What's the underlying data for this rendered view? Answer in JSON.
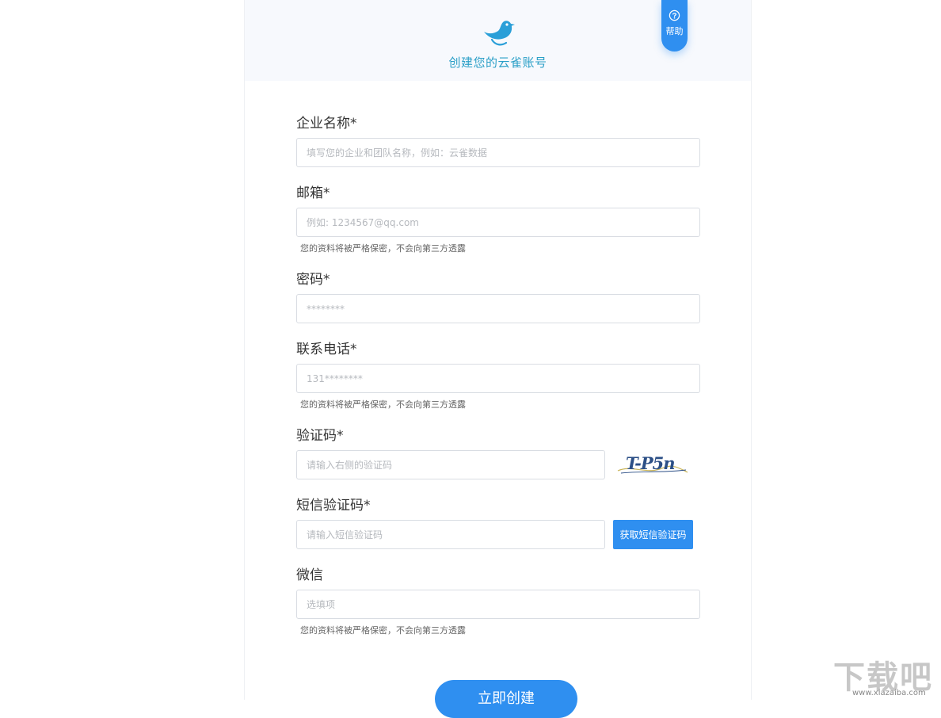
{
  "header": {
    "brand_title": "创建您的云雀账号",
    "help_label": "帮助"
  },
  "form": {
    "company": {
      "label": "企业名称*",
      "placeholder": "填写您的企业和团队名称，例如：云雀数据"
    },
    "email": {
      "label": "邮箱*",
      "placeholder": "例如: 1234567@qq.com",
      "hint": "您的资料将被严格保密，不会向第三方透露"
    },
    "password": {
      "label": "密码*",
      "placeholder": "********"
    },
    "phone": {
      "label": "联系电话*",
      "placeholder": "131********",
      "hint": "您的资料将被严格保密，不会向第三方透露"
    },
    "captcha": {
      "label": "验证码*",
      "placeholder": "请输入右侧的验证码",
      "image_text": "T-P5n"
    },
    "sms": {
      "label": "短信验证码*",
      "placeholder": "请输入短信验证码",
      "button_label": "获取短信验证码"
    },
    "wechat": {
      "label": "微信",
      "placeholder": "选填项",
      "hint": "您的资料将被严格保密，不会向第三方透露"
    },
    "submit_label": "立即创建"
  },
  "watermark": {
    "brand": "下载吧",
    "site": "www.xiazaiba.com"
  },
  "colors": {
    "primary": "#2f8ff0",
    "brand_text": "#2a9fc7",
    "header_bg": "#f7f9fd"
  },
  "icons": {
    "logo": "bird-logo-icon",
    "help": "question-circle-icon"
  }
}
